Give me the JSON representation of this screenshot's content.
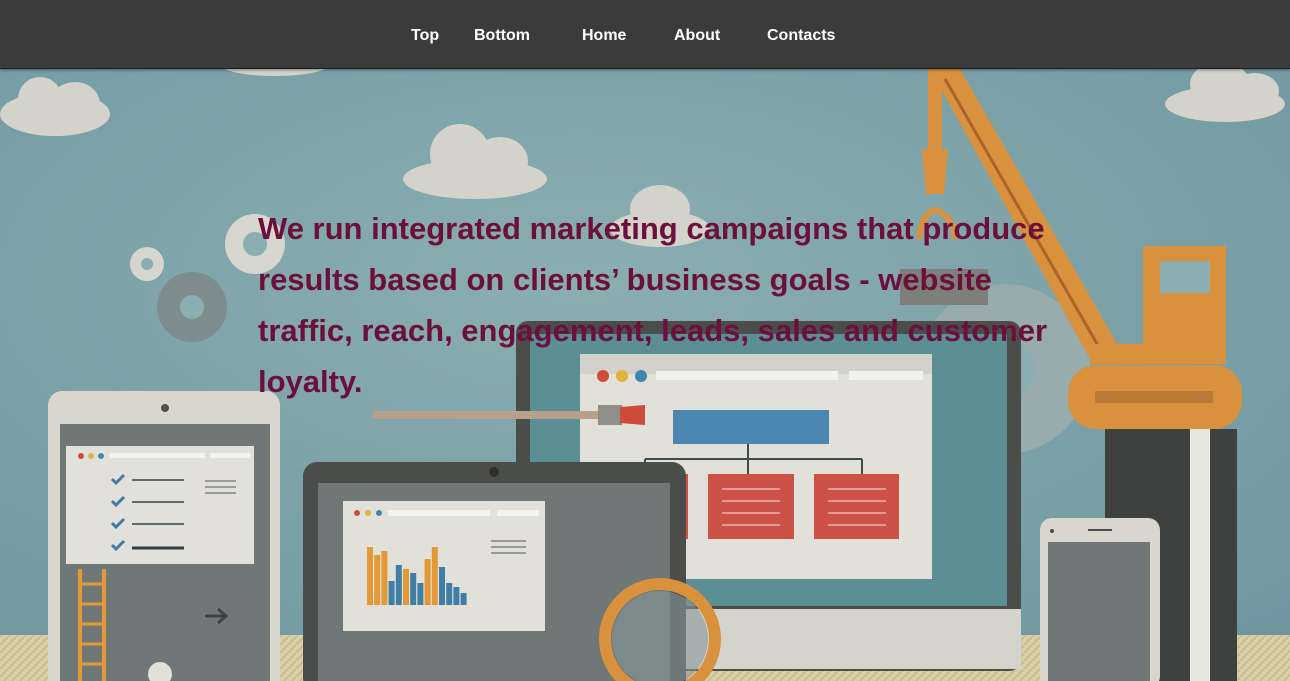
{
  "nav": {
    "items": [
      {
        "label": "Top"
      },
      {
        "label": "Bottom"
      },
      {
        "label": "Home"
      },
      {
        "label": "About"
      },
      {
        "label": "Contacts"
      }
    ]
  },
  "hero": {
    "headline": "We run integrated marketing campaigns that produce results based on clients’ business goals - website traffic, reach, engagement, leads, sales and customer loyalty."
  },
  "colors": {
    "nav_background": "#3b3b3b",
    "headline": "#6d0f3c",
    "sky": "#7ea3a8",
    "crane": "#d9913e",
    "chart_bar_orange": "#e39a36",
    "chart_bar_blue": "#3f7fa6",
    "card_red": "#cc5248"
  }
}
